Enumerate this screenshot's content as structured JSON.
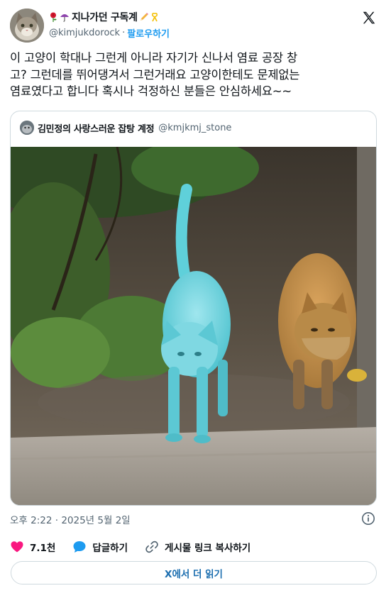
{
  "author": {
    "display_name": "지나가던 구독계",
    "handle": "@kimjukdorock",
    "follow_label": "팔로우하기",
    "dot": "·"
  },
  "tweet": {
    "lines": [
      "이 고양이 학대나 그런게 아니라 자기가 신나서 염료 공장 창",
      "고? 그런데를 뛰어댕겨서 그런거래요 고양이한테도 문제없는",
      "염료였다고 합니다 혹시나 걱정하신 분들은 안심하세요~~"
    ]
  },
  "quote": {
    "display_name": "김민정의 사랑스러운 잡탕 계정",
    "handle": "@kmjkmj_stone"
  },
  "meta": {
    "time": "오후 2:22 · 2025년 5월 2일"
  },
  "actions": {
    "like_count": "7.1천",
    "reply_label": "답글하기",
    "copy_link_label": "게시물 링크 복사하기"
  },
  "read_more_label": "X에서 더 읽기",
  "colors": {
    "accent": "#1d9bf0",
    "like": "#f91880",
    "reply": "#1d9bf0",
    "secondary_text": "#536471",
    "border": "#cfd9de"
  },
  "icons": {
    "x_logo": "x-logo-icon",
    "info": "info-icon",
    "heart": "heart-icon",
    "reply": "speech-bubble-icon",
    "link": "link-icon"
  }
}
